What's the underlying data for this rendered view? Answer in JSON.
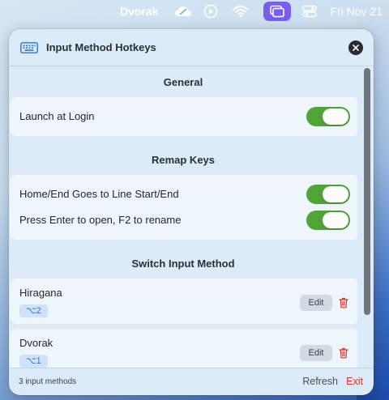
{
  "menubar": {
    "keyboard_layout": "Dvorak",
    "date": "Fri Nov 21",
    "icons": [
      "cloud-icon",
      "play-circle-icon",
      "wifi-icon",
      "window-stack-icon",
      "control-center-icon"
    ]
  },
  "panel": {
    "title": "Input Method Hotkeys",
    "sections": {
      "general": {
        "title": "General",
        "launch_at_login_label": "Launch at Login",
        "launch_at_login_on": true
      },
      "remap": {
        "title": "Remap Keys",
        "home_end_label": "Home/End Goes to Line Start/End",
        "home_end_on": true,
        "enter_f2_label": "Press Enter to open, F2 to rename",
        "enter_f2_on": true
      },
      "switch": {
        "title": "Switch Input Method",
        "items": [
          {
            "name": "Hiragana",
            "hotkey": "⌥2",
            "edit_label": "Edit"
          },
          {
            "name": "Dvorak",
            "hotkey": "⌥1",
            "edit_label": "Edit"
          }
        ]
      }
    },
    "footer": {
      "count_text": "3 input methods",
      "refresh_label": "Refresh",
      "exit_label": "Exit"
    }
  },
  "colors": {
    "toggle_on": "#4ea536",
    "accent_purple": "#7b5cf0",
    "exit_red": "#d8322c",
    "hotkey_blue": "#2f6fd0"
  }
}
